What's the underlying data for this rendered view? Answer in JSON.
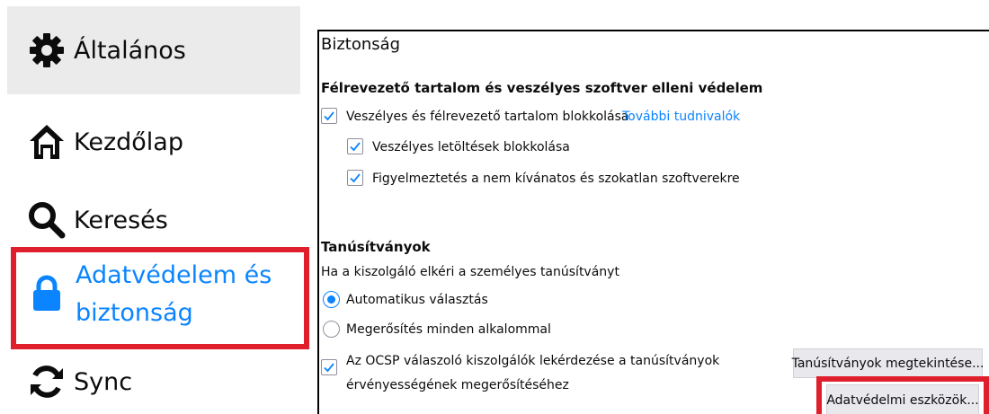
{
  "sidebar": {
    "items": [
      {
        "label": "Általános",
        "icon": "gear-icon"
      },
      {
        "label": "Kezdőlap",
        "icon": "home-icon"
      },
      {
        "label": "Keresés",
        "icon": "search-icon"
      },
      {
        "label_line1": "Adatvédelem és",
        "label_line2": "biztonság",
        "icon": "lock-icon",
        "active": true
      },
      {
        "label": "Sync",
        "icon": "sync-icon"
      }
    ]
  },
  "security": {
    "title": "Biztonság",
    "deceptive": {
      "heading": "Félrevezető tartalom és veszélyes szoftver elleni védelem",
      "block_label": "Veszélyes és félrevezető tartalom blokkolása",
      "block_checked": true,
      "learn_more": "További tudnivalók",
      "downloads_label": "Veszélyes letöltések blokkolása",
      "downloads_checked": true,
      "unwanted_label": "Figyelmeztetés a nem kívánatos és szokatlan szoftverekre",
      "unwanted_checked": true
    },
    "certificates": {
      "heading": "Tanúsítványok",
      "description": "Ha a kiszolgáló elkéri a személyes tanúsítványt",
      "auto_label": "Automatikus választás",
      "auto_selected": true,
      "ask_label": "Megerősítés minden alkalommal",
      "ocsp_line1": "Az OCSP válaszoló kiszolgálók lekérdezése a tanúsítványok",
      "ocsp_line2": "érvényességének megerősítéséhez",
      "ocsp_checked": true,
      "view_button": "Tanúsítványok megtekintése...",
      "devices_button": "Adatvédelmi eszközök..."
    }
  },
  "colors": {
    "accent": "#0a84ff",
    "highlight": "#e01f2c",
    "selected_bg": "#ebebeb"
  }
}
